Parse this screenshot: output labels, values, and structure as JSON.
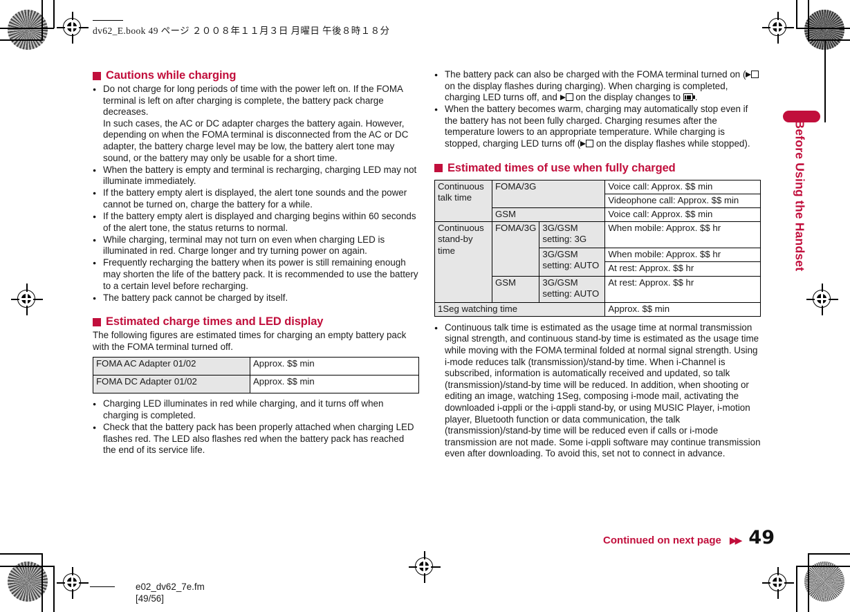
{
  "book_header": "dv62_E.book   49 ページ   ２００８年１１月３日   月曜日   午後８時１８分",
  "side_tab": {
    "label": "Before Using the Handset",
    "color": "#C10F3C"
  },
  "accent_color": "#C10F3C",
  "left_column": {
    "heading1": "Cautions while charging",
    "bullets1": [
      "Do not charge for long periods of time with the power left on. If the FOMA terminal is left on after charging is complete, the battery pack charge decreases.\nIn such cases, the AC or DC adapter charges the battery again. However, depending on when the FOMA terminal is disconnected from the AC or DC adapter, the battery charge level may be low, the battery alert tone may sound, or the battery may only be usable for a short time.",
      "When the battery is empty and terminal is recharging, charging LED may not illuminate immediately.",
      "If the battery empty alert is displayed, the alert tone sounds and the power cannot be turned on, charge the battery for a while.",
      "If the battery empty alert is displayed and charging begins within 60 seconds of the alert tone, the status returns to normal.",
      "While charging, terminal may not turn on even when charging LED is illuminated in red. Charge longer and try turning power on again.",
      "Frequently recharging the battery when its power is still remaining enough may shorten the life of the battery pack. It is recommended to use the battery to a certain level before recharging.",
      "The battery pack cannot be charged by itself."
    ],
    "heading2": "Estimated charge times and LED display",
    "intro2": "The following figures are estimated times for charging an empty battery pack with the FOMA terminal turned off.",
    "charge_table": {
      "rows": [
        {
          "label": "FOMA AC Adapter 01/02",
          "value": "Approx. $$ min"
        },
        {
          "label": "FOMA DC Adapter 01/02",
          "value": "Approx. $$ min"
        }
      ]
    },
    "bullets2": [
      "Charging LED illuminates in red while charging, and it turns off when charging is completed.",
      "Check that the battery pack has been properly attached when charging LED flashes red. The LED also flashes red when the battery pack has reached the end of its service life."
    ]
  },
  "right_column": {
    "bullet_charge_on": {
      "p1": "The battery pack can also be charged with the FOMA terminal turned on (",
      "p2": " on the display flashes during charging).",
      "p3": "When charging is completed, charging LED turns off, and ",
      "p4": " on the display changes to ",
      "p5": "."
    },
    "bullet_warm": {
      "p1": "When the battery becomes warm, charging may automatically stop even if the battery has not been fully charged. Charging resumes after the temperature lowers to an appropriate temperature. While charging is stopped, charging LED turns off (",
      "p2": " on the display flashes while stopped)."
    },
    "heading": "Estimated times of use when fully charged",
    "use_table": {
      "r1_c1": "Continuous talk time",
      "r1_c2": "FOMA/3G",
      "r1_c3": "Voice call: Approx. $$ min",
      "r2_c3": "Videophone call: Approx. $$ min",
      "r3_c2": "GSM",
      "r3_c3": "Voice call: Approx. $$ min",
      "r4_c1": "Continuous stand-by time",
      "r4_c2": "FOMA/3G",
      "r4_c3": "3G/GSM setting: 3G",
      "r4_c4": "When mobile: Approx. $$ hr",
      "r5_c3": "3G/GSM setting: AUTO",
      "r5_c4": "When mobile: Approx. $$ hr",
      "r6_c4": "At rest: Approx. $$ hr",
      "r7_c2": "GSM",
      "r7_c3": "3G/GSM setting: AUTO",
      "r7_c4": "At rest: Approx. $$ hr",
      "r8_c1": "1Seg watching time",
      "r8_c4": "Approx. $$ min"
    },
    "note": "Continuous talk time is estimated as the usage time at normal transmission signal strength, and continuous stand-by time is estimated as the usage time while moving with the FOMA terminal folded at normal signal strength. Using i-mode reduces talk (transmission)/stand-by time. When i-Channel is subscribed, information is automatically received and updated, so talk (transmission)/stand-by time will be reduced. In addition, when shooting or editing an image, watching 1Seg, composing i-mode mail, activating the downloaded i-αppli or the i-αppli stand-by, or using MUSIC Player, i-motion player, Bluetooth function or data communication, the talk (transmission)/stand-by time will be reduced even if calls or i-mode transmission are not made. Some i-αppli software may continue transmission even after downloading. To avoid this, set not to connect in advance."
  },
  "footer": {
    "continued_label": "Continued on next page",
    "continued_arrows": "▶▶",
    "page_number": "49",
    "file_name": "e02_dv62_7e.fm",
    "page_range": "[49/56]"
  }
}
